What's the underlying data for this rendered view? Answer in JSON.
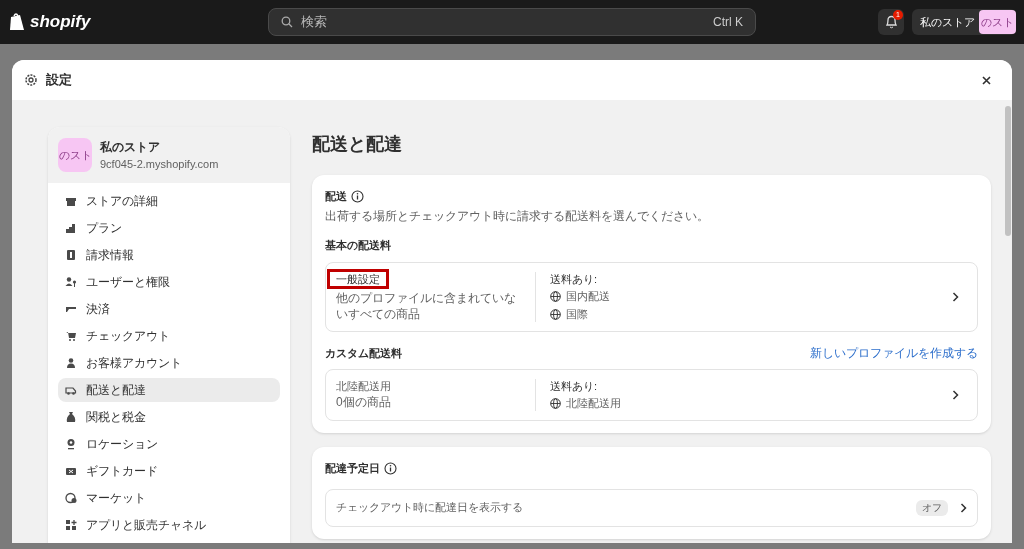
{
  "topbar": {
    "logo": "shopify",
    "search": {
      "placeholder": "検索",
      "shortcut": "Ctrl K"
    },
    "notifications": "1",
    "store_button": "私のストア",
    "avatar": "のスト"
  },
  "modal": {
    "title": "設定"
  },
  "sidebar": {
    "store": {
      "avatar": "のスト",
      "name": "私のストア",
      "domain": "9cf045-2.myshopify.com"
    },
    "items": [
      {
        "label": "ストアの詳細",
        "selected": false
      },
      {
        "label": "プラン",
        "selected": false
      },
      {
        "label": "請求情報",
        "selected": false
      },
      {
        "label": "ユーザーと権限",
        "selected": false
      },
      {
        "label": "決済",
        "selected": false
      },
      {
        "label": "チェックアウト",
        "selected": false
      },
      {
        "label": "お客様アカウント",
        "selected": false
      },
      {
        "label": "配送と配達",
        "selected": true
      },
      {
        "label": "関税と税金",
        "selected": false
      },
      {
        "label": "ロケーション",
        "selected": false
      },
      {
        "label": "ギフトカード",
        "selected": false
      },
      {
        "label": "マーケット",
        "selected": false
      },
      {
        "label": "アプリと販売チャネル",
        "selected": false
      }
    ]
  },
  "page_title": "配送と配達",
  "shipping": {
    "title": "配送",
    "description": "出荷する場所とチェックアウト時に請求する配送料を選んでください。",
    "general_heading": "基本の配送料",
    "general_profile": {
      "name": "一般設定",
      "highlighted": true,
      "description": "他のプロファイルに含まれていないすべての商品",
      "rates_label": "送料あり:",
      "zones": [
        "国内配送",
        "国際"
      ]
    },
    "custom_heading": "カスタム配送料",
    "create_link": "新しいプロファイルを作成する",
    "custom_profiles": [
      {
        "name": "北陸配送用",
        "highlighted": false,
        "description": "0個の商品",
        "rates_label": "送料あり:",
        "zones": [
          "北陸配送用"
        ]
      }
    ]
  },
  "delivery_dates": {
    "title": "配達予定日",
    "row": {
      "label": "チェックアウト時に配達日を表示する",
      "status": "オフ"
    }
  }
}
